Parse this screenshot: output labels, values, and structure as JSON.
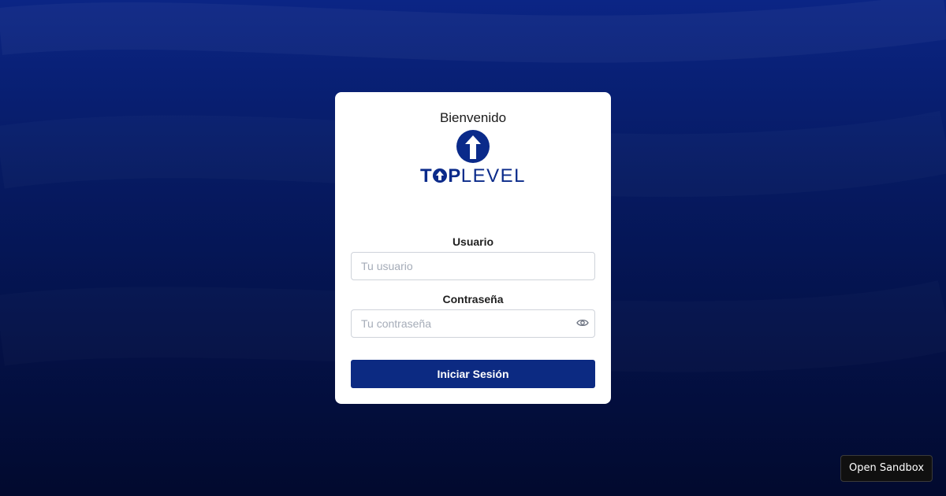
{
  "login": {
    "welcome": "Bienvenido",
    "logo": {
      "text_bold_1": "T",
      "text_bold_2": "P",
      "text_light": "LEVEL",
      "brand_color": "#0a2a8a"
    },
    "username": {
      "label": "Usuario",
      "placeholder": "Tu usuario",
      "value": ""
    },
    "password": {
      "label": "Contraseña",
      "placeholder": "Tu contraseña",
      "value": "",
      "toggle_icon": "eye-icon"
    },
    "submit_label": "Iniciar Sesión",
    "submit_color": "#0c2a82"
  },
  "sandbox_button": {
    "label": "Open Sandbox"
  },
  "background": {
    "top_color": "#0b2585",
    "bottom_color": "#020a2e"
  }
}
